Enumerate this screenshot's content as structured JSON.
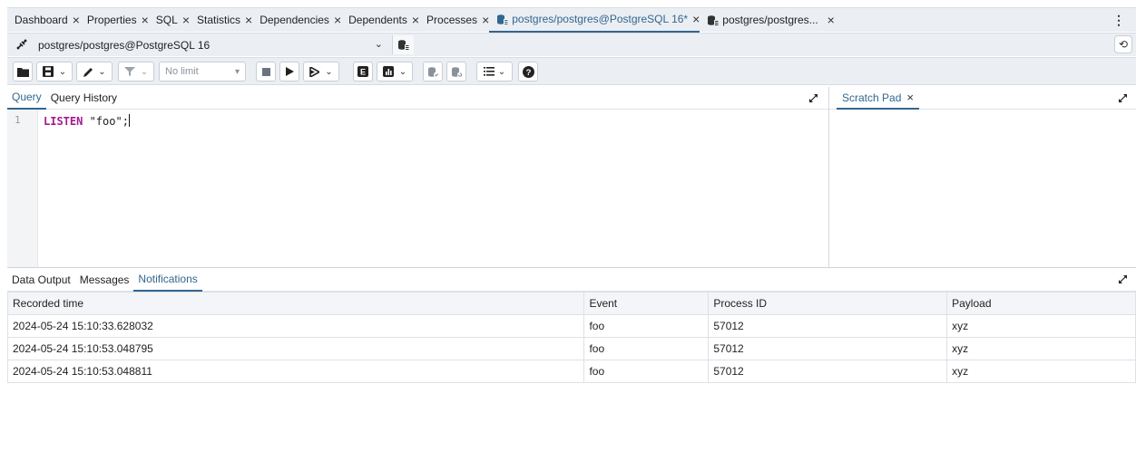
{
  "tabs": [
    {
      "label": "Dashboard"
    },
    {
      "label": "Properties"
    },
    {
      "label": "SQL"
    },
    {
      "label": "Statistics"
    },
    {
      "label": "Dependencies"
    },
    {
      "label": "Dependents"
    },
    {
      "label": "Processes"
    },
    {
      "label": "postgres/postgres@PostgreSQL 16*"
    },
    {
      "label": "postgres/postgres..."
    }
  ],
  "tab_close_glyph": "×",
  "menu_glyph": "⋮",
  "connection": {
    "label": "postgres/postgres@PostgreSQL 16",
    "reset_glyph": "⟲"
  },
  "toolbar": {
    "row_limit": "No limit"
  },
  "editor": {
    "tabs": [
      "Query",
      "Query History"
    ],
    "line_number": "1",
    "keyword": "LISTEN",
    "rest": " \"foo\";"
  },
  "scratch": {
    "label": "Scratch Pad"
  },
  "output": {
    "tabs": [
      "Data Output",
      "Messages",
      "Notifications"
    ],
    "columns": [
      "Recorded time",
      "Event",
      "Process ID",
      "Payload"
    ],
    "rows": [
      [
        "2024-05-24 15:10:33.628032",
        "foo",
        "57012",
        "xyz"
      ],
      [
        "2024-05-24 15:10:53.048795",
        "foo",
        "57012",
        "xyz"
      ],
      [
        "2024-05-24 15:10:53.048811",
        "foo",
        "57012",
        "xyz"
      ]
    ]
  },
  "colors": {
    "accent": "#326690",
    "keyword": "#a6188f",
    "panel_bg": "#ebeef3"
  }
}
